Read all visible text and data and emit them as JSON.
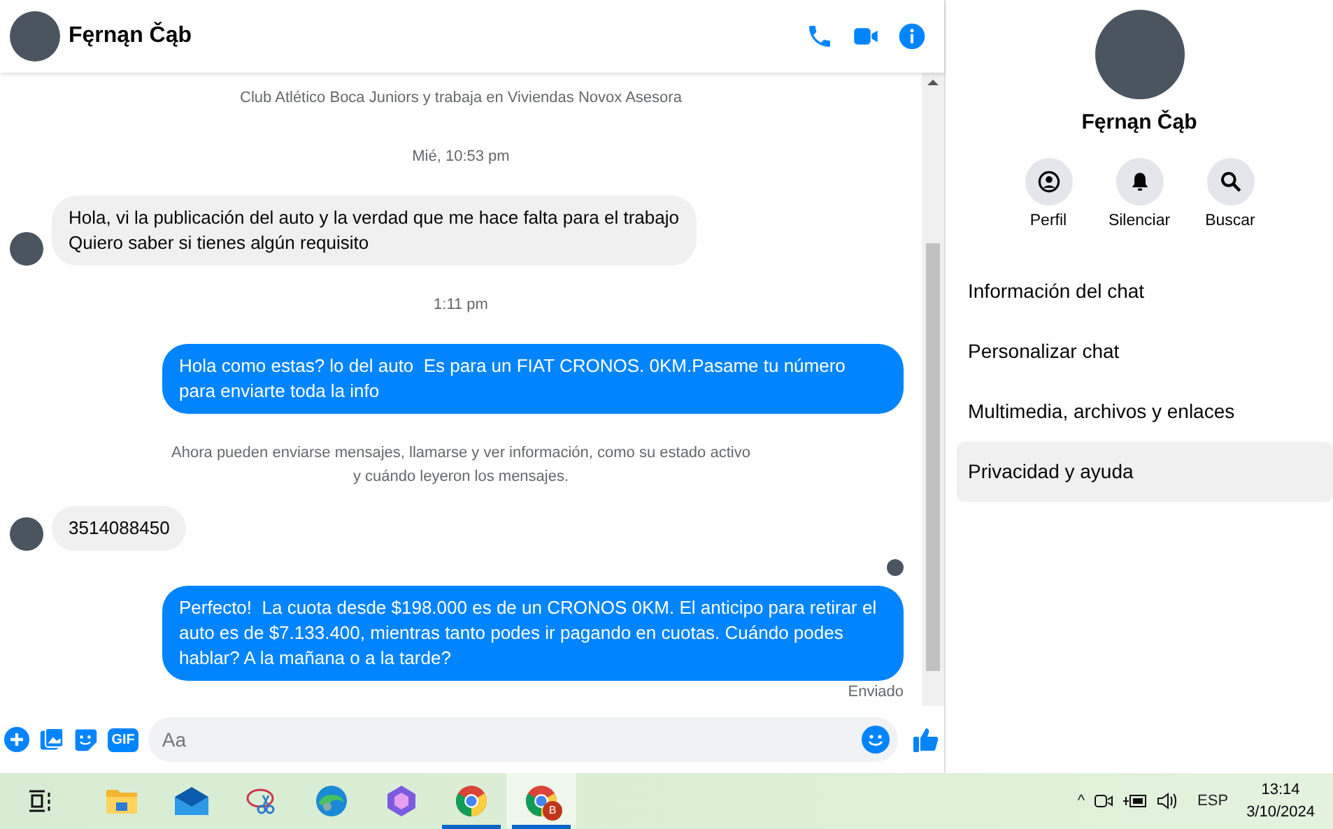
{
  "chat": {
    "contact_name": "Fęrnąn Čąb",
    "header_actions": [
      {
        "kind": "phone"
      },
      {
        "kind": "video"
      },
      {
        "kind": "info"
      }
    ],
    "messages": [
      {
        "kind": "system",
        "text": "Club Atlético Boca Juniors y trabaja en Viviendas Novox Asesora"
      },
      {
        "kind": "timestamp",
        "text": "Mié, 10:53 pm"
      },
      {
        "kind": "incoming",
        "text": "Hola, vi la publicación del auto y la verdad que me hace falta para el trabajo\nQuiero saber si tienes algún requisito"
      },
      {
        "kind": "timestamp",
        "text": "1:11 pm"
      },
      {
        "kind": "outgoing",
        "text": "Hola como estas? lo del auto  Es para un FIAT CRONOS. 0KM.Pasame tu número para enviarte toda la info"
      },
      {
        "kind": "system",
        "text": "Ahora pueden enviarse mensajes, llamarse y ver información, como su estado activo\ny cuándo leyeron los mensajes."
      },
      {
        "kind": "incoming",
        "text": "3514088450"
      },
      {
        "kind": "seen"
      },
      {
        "kind": "outgoing",
        "text": "Perfecto!  La cuota desde $198.000 es de un CRONOS 0KM. El anticipo para retirar el auto es de $7.133.400, mientras tanto podes ir pagando en cuotas. Cuándo podes hablar? A la mañana o a la tarde?"
      },
      {
        "kind": "status",
        "text": "Enviado"
      }
    ],
    "composer": {
      "tools": [
        {
          "kind": "plus"
        },
        {
          "kind": "image"
        },
        {
          "kind": "sticker"
        },
        {
          "kind": "gif",
          "text": "GIF"
        }
      ],
      "placeholder": "Aa"
    }
  },
  "info_panel": {
    "name": "Fęrnąn Čąb",
    "actions": [
      {
        "kind": "profile",
        "label": "Perfil"
      },
      {
        "kind": "mute",
        "label": "Silenciar"
      },
      {
        "kind": "search",
        "label": "Buscar"
      }
    ],
    "items": [
      {
        "label": "Información del chat",
        "selected": false
      },
      {
        "label": "Personalizar chat",
        "selected": false
      },
      {
        "label": "Multimedia, archivos y enlaces",
        "selected": false
      },
      {
        "label": "Privacidad y ayuda",
        "selected": true
      }
    ]
  },
  "taskbar": {
    "apps": [
      {
        "kind": "taskview",
        "running": false,
        "selected": false
      },
      {
        "kind": "folder",
        "running": false,
        "selected": false
      },
      {
        "kind": "mail",
        "running": false,
        "selected": false
      },
      {
        "kind": "snip",
        "running": false,
        "selected": false
      },
      {
        "kind": "edge",
        "running": false,
        "selected": false
      },
      {
        "kind": "copilot",
        "running": false,
        "selected": false
      },
      {
        "kind": "chrome",
        "running": true,
        "selected": false
      },
      {
        "kind": "chrome",
        "running": true,
        "selected": true,
        "badge": "B"
      }
    ],
    "tray": {
      "chevron": "^",
      "language": "ESP",
      "time": "13:14",
      "date": "3/10/2024"
    }
  }
}
